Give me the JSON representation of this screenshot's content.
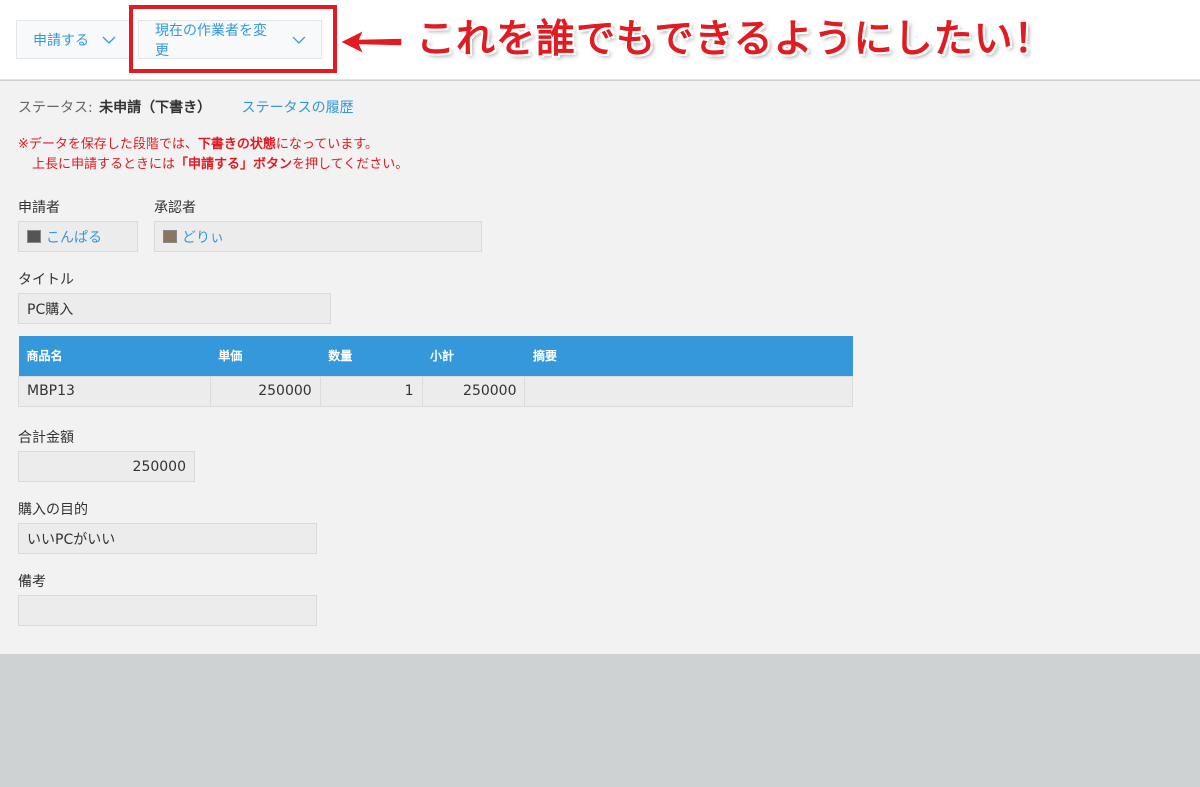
{
  "toolbar": {
    "apply_label": "申請する",
    "change_assignee_label": "現在の作業者を変更"
  },
  "annotation": {
    "callout": "これを誰でもできるようにしたい！",
    "color": "#e01b22"
  },
  "status": {
    "label": "ステータス:",
    "value": "未申請（下書き）",
    "history_link": "ステータスの履歴"
  },
  "notice": {
    "prefix": "※データを保存した段階では、",
    "bold1": "下書きの状態",
    "suffix1": "になっています。",
    "line2_prefix": "上長に申請するときには",
    "bold2": "「申請する」ボタン",
    "suffix2": "を押してください。"
  },
  "form": {
    "applicant_label": "申請者",
    "applicant_name": "こんぱる",
    "approver_label": "承認者",
    "approver_name": "どりぃ",
    "title_label": "タイトル",
    "title_value": "PC購入",
    "total_label": "合計金額",
    "total_value": "250000",
    "purpose_label": "購入の目的",
    "purpose_value": "いいPCがいい",
    "remarks_label": "備考",
    "remarks_value": ""
  },
  "table": {
    "headers": [
      "商品名",
      "単価",
      "数量",
      "小計",
      "摘要"
    ],
    "rows": [
      [
        "MBP13",
        "250000",
        "1",
        "250000",
        ""
      ]
    ]
  },
  "colors": {
    "accent": "#3498db",
    "alert": "#e01b22",
    "panel": "#f2f2f2",
    "footer": "#cfd2d3"
  }
}
